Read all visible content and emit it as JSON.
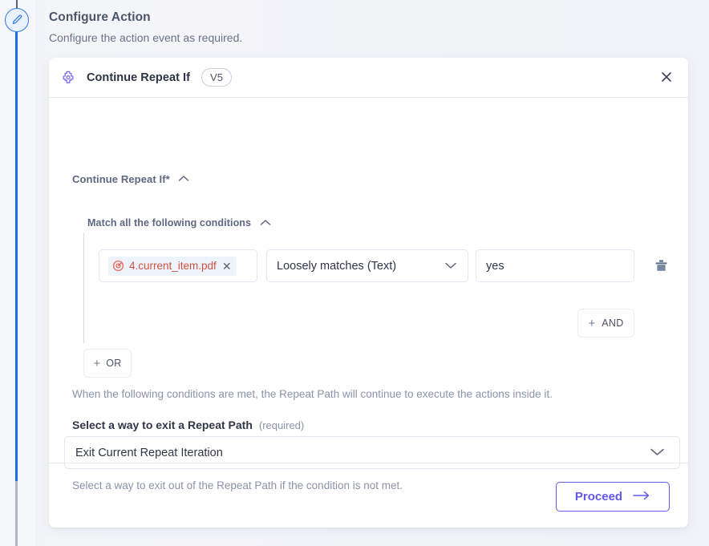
{
  "page": {
    "title": "Configure Action",
    "subtitle": "Configure the action event as required."
  },
  "rail": {
    "icon": "pencil-edit-icon"
  },
  "card": {
    "header": {
      "icon": "gear-action-icon",
      "title": "Continue Repeat If",
      "version": "V5",
      "close_icon": "close-icon"
    },
    "section": {
      "label": "Continue Repeat If*",
      "collapse_icon": "chevron-up-icon"
    },
    "conditions": {
      "match_label": "Match all the following conditions",
      "match_collapse_icon": "chevron-up-icon",
      "rows": [
        {
          "token_icon": "target-variable-icon",
          "token_text": "4.current_item.pdf",
          "token_remove_icon": "remove-token-icon",
          "operator": "Loosely matches (Text)",
          "operator_chevron": "chevron-down-icon",
          "value": "yes",
          "value_placeholder": "",
          "delete_icon": "trash-icon"
        }
      ],
      "and_button": {
        "plus_icon": "plus-icon",
        "label": "AND"
      },
      "or_button": {
        "plus_icon": "plus-icon",
        "label": "OR"
      },
      "hint": "When the following conditions are met, the Repeat Path will continue to execute the actions inside it."
    },
    "exit_field": {
      "label": "Select a way to exit a Repeat Path",
      "required_note": "(required)",
      "selected": "Exit Current Repeat Iteration",
      "chevron_icon": "chevron-down-icon",
      "hint": "Select a way to exit out of the Repeat Path if the condition is not met."
    },
    "footer": {
      "proceed_label": "Proceed",
      "proceed_icon": "arrow-right-icon"
    }
  },
  "colors": {
    "accent_purple": "#6359e6",
    "rail_blue": "#1b6ae0",
    "token_red": "#d0503f",
    "muted_text": "#8a93a8"
  }
}
